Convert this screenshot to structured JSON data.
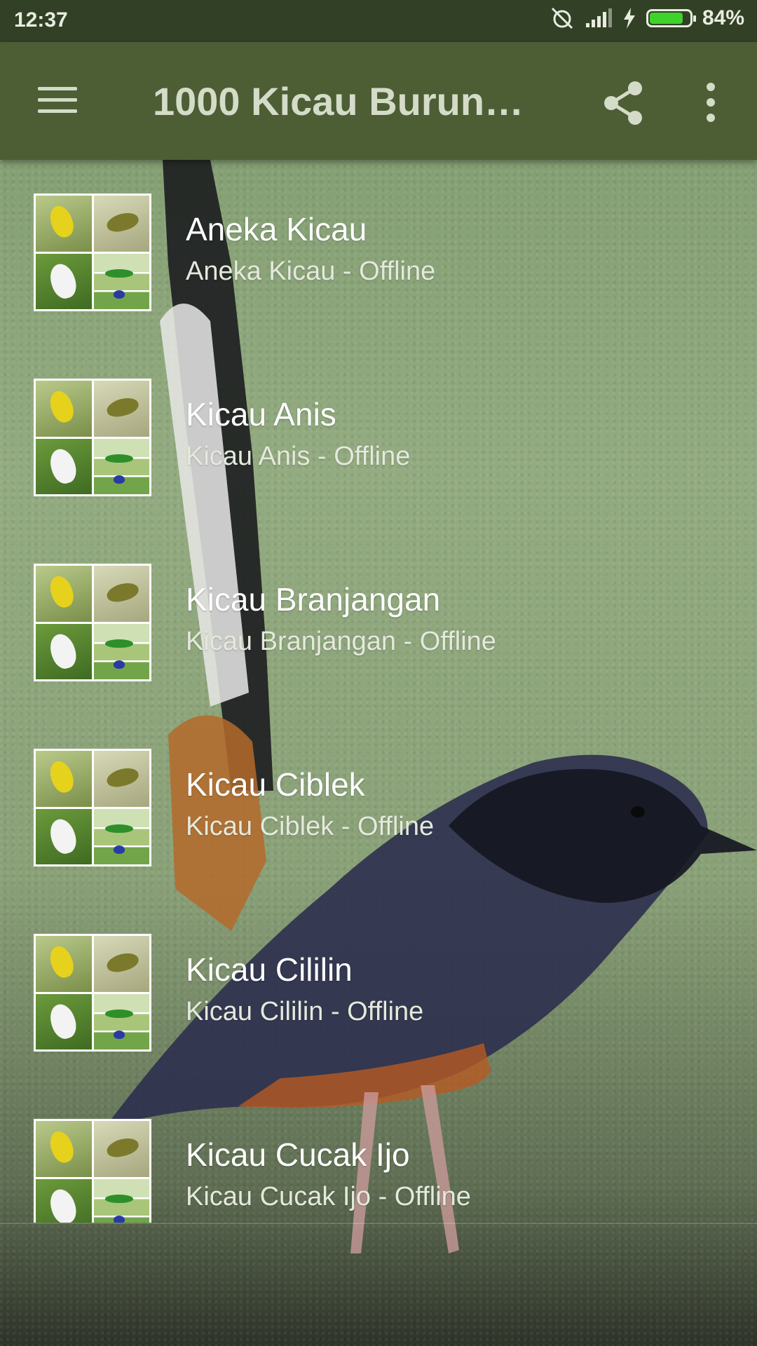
{
  "status_bar": {
    "time": "12:37",
    "battery_percent": "84%",
    "battery_level": 0.84,
    "icons": [
      "alarm-off-icon",
      "signal-icon",
      "charging-icon",
      "battery-icon"
    ]
  },
  "app_bar": {
    "title": "1000 Kicau Burung Offline",
    "icons": [
      "menu-icon",
      "share-icon",
      "more-vert-icon"
    ]
  },
  "list": {
    "items": [
      {
        "title": "Aneka Kicau",
        "subtitle": "Aneka Kicau - Offline"
      },
      {
        "title": "Kicau Anis",
        "subtitle": "Kicau Anis - Offline"
      },
      {
        "title": "Kicau Branjangan",
        "subtitle": "Kicau Branjangan - Offline"
      },
      {
        "title": "Kicau Ciblek",
        "subtitle": "Kicau Ciblek - Offline"
      },
      {
        "title": "Kicau Cililin",
        "subtitle": "Kicau Cililin - Offline"
      },
      {
        "title": "Kicau Cucak Ijo",
        "subtitle": "Kicau Cucak Ijo - Offline"
      }
    ]
  },
  "colors": {
    "status_bar": "#324026",
    "app_bar": "#4d5e35",
    "app_bar_text": "#d4dbc8",
    "battery_fill": "#3fd22b"
  }
}
